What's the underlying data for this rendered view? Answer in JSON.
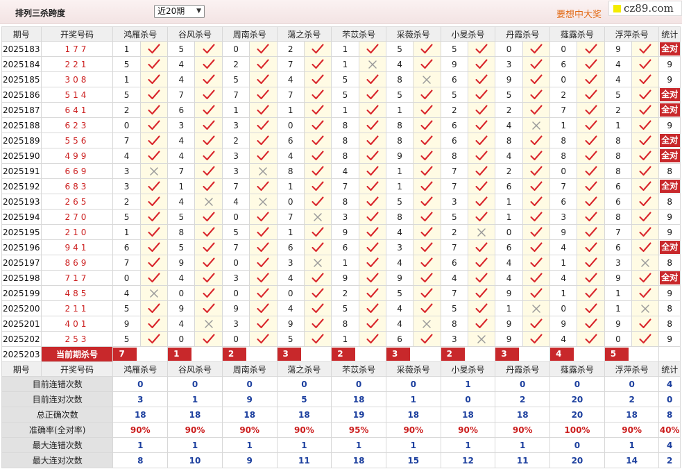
{
  "header": {
    "title": "排列三杀跨度",
    "period_select": "近20期",
    "promo": "要想中大奖",
    "logo_text": "cz89.com"
  },
  "columns": {
    "period": "期号",
    "winning": "开奖号码",
    "experts": [
      "鸿雁杀号",
      "谷风杀号",
      "周南杀号",
      "蕩之杀号",
      "芣苡杀号",
      "采薇杀号",
      "小旻杀号",
      "丹霞杀号",
      "薤露杀号",
      "浮萍杀号"
    ],
    "stat": "统计"
  },
  "icons": {
    "correct": "check-icon",
    "wrong": "cross-icon"
  },
  "colors": {
    "accent_red": "#c8282b",
    "check_red": "#d9262c",
    "cross_gray": "#9a9a9a",
    "stat_blue": "#1c3f9e",
    "marker_bg": "#fffbe4"
  },
  "rows": [
    {
      "period": "2025183",
      "numbers": "177",
      "picks": [
        [
          1,
          1
        ],
        [
          5,
          1
        ],
        [
          0,
          1
        ],
        [
          2,
          1
        ],
        [
          1,
          1
        ],
        [
          5,
          1
        ],
        [
          5,
          1
        ],
        [
          0,
          1
        ],
        [
          0,
          1
        ],
        [
          9,
          1
        ]
      ],
      "stat": "全对",
      "all_correct": true
    },
    {
      "period": "2025184",
      "numbers": "221",
      "picks": [
        [
          5,
          1
        ],
        [
          4,
          1
        ],
        [
          2,
          1
        ],
        [
          7,
          1
        ],
        [
          1,
          0
        ],
        [
          4,
          1
        ],
        [
          9,
          1
        ],
        [
          3,
          1
        ],
        [
          6,
          1
        ],
        [
          4,
          1
        ]
      ],
      "stat": "9",
      "all_correct": false
    },
    {
      "period": "2025185",
      "numbers": "308",
      "picks": [
        [
          1,
          1
        ],
        [
          4,
          1
        ],
        [
          5,
          1
        ],
        [
          4,
          1
        ],
        [
          5,
          1
        ],
        [
          8,
          0
        ],
        [
          6,
          1
        ],
        [
          9,
          1
        ],
        [
          0,
          1
        ],
        [
          4,
          1
        ]
      ],
      "stat": "9",
      "all_correct": false
    },
    {
      "period": "2025186",
      "numbers": "514",
      "picks": [
        [
          5,
          1
        ],
        [
          7,
          1
        ],
        [
          7,
          1
        ],
        [
          7,
          1
        ],
        [
          5,
          1
        ],
        [
          5,
          1
        ],
        [
          5,
          1
        ],
        [
          5,
          1
        ],
        [
          2,
          1
        ],
        [
          5,
          1
        ]
      ],
      "stat": "全对",
      "all_correct": true
    },
    {
      "period": "2025187",
      "numbers": "641",
      "picks": [
        [
          2,
          1
        ],
        [
          6,
          1
        ],
        [
          1,
          1
        ],
        [
          1,
          1
        ],
        [
          1,
          1
        ],
        [
          1,
          1
        ],
        [
          2,
          1
        ],
        [
          2,
          1
        ],
        [
          7,
          1
        ],
        [
          2,
          1
        ]
      ],
      "stat": "全对",
      "all_correct": true
    },
    {
      "period": "2025188",
      "numbers": "623",
      "picks": [
        [
          0,
          1
        ],
        [
          3,
          1
        ],
        [
          3,
          1
        ],
        [
          0,
          1
        ],
        [
          8,
          1
        ],
        [
          8,
          1
        ],
        [
          6,
          1
        ],
        [
          4,
          0
        ],
        [
          1,
          1
        ],
        [
          1,
          1
        ]
      ],
      "stat": "9",
      "all_correct": false
    },
    {
      "period": "2025189",
      "numbers": "556",
      "picks": [
        [
          7,
          1
        ],
        [
          4,
          1
        ],
        [
          2,
          1
        ],
        [
          6,
          1
        ],
        [
          8,
          1
        ],
        [
          8,
          1
        ],
        [
          6,
          1
        ],
        [
          8,
          1
        ],
        [
          8,
          1
        ],
        [
          8,
          1
        ]
      ],
      "stat": "全对",
      "all_correct": true
    },
    {
      "period": "2025190",
      "numbers": "499",
      "picks": [
        [
          4,
          1
        ],
        [
          4,
          1
        ],
        [
          3,
          1
        ],
        [
          4,
          1
        ],
        [
          8,
          1
        ],
        [
          9,
          1
        ],
        [
          8,
          1
        ],
        [
          4,
          1
        ],
        [
          8,
          1
        ],
        [
          8,
          1
        ]
      ],
      "stat": "全对",
      "all_correct": true
    },
    {
      "period": "2025191",
      "numbers": "669",
      "picks": [
        [
          3,
          0
        ],
        [
          7,
          1
        ],
        [
          3,
          0
        ],
        [
          8,
          1
        ],
        [
          4,
          1
        ],
        [
          1,
          1
        ],
        [
          7,
          1
        ],
        [
          2,
          1
        ],
        [
          0,
          1
        ],
        [
          8,
          1
        ]
      ],
      "stat": "8",
      "all_correct": false
    },
    {
      "period": "2025192",
      "numbers": "683",
      "picks": [
        [
          3,
          1
        ],
        [
          1,
          1
        ],
        [
          7,
          1
        ],
        [
          1,
          1
        ],
        [
          7,
          1
        ],
        [
          1,
          1
        ],
        [
          7,
          1
        ],
        [
          6,
          1
        ],
        [
          7,
          1
        ],
        [
          6,
          1
        ]
      ],
      "stat": "全对",
      "all_correct": true
    },
    {
      "period": "2025193",
      "numbers": "265",
      "picks": [
        [
          2,
          1
        ],
        [
          4,
          0
        ],
        [
          4,
          0
        ],
        [
          0,
          1
        ],
        [
          8,
          1
        ],
        [
          5,
          1
        ],
        [
          3,
          1
        ],
        [
          1,
          1
        ],
        [
          6,
          1
        ],
        [
          6,
          1
        ]
      ],
      "stat": "8",
      "all_correct": false
    },
    {
      "period": "2025194",
      "numbers": "270",
      "picks": [
        [
          5,
          1
        ],
        [
          5,
          1
        ],
        [
          0,
          1
        ],
        [
          7,
          0
        ],
        [
          3,
          1
        ],
        [
          8,
          1
        ],
        [
          5,
          1
        ],
        [
          1,
          1
        ],
        [
          3,
          1
        ],
        [
          8,
          1
        ]
      ],
      "stat": "9",
      "all_correct": false
    },
    {
      "period": "2025195",
      "numbers": "210",
      "picks": [
        [
          1,
          1
        ],
        [
          8,
          1
        ],
        [
          5,
          1
        ],
        [
          1,
          1
        ],
        [
          9,
          1
        ],
        [
          4,
          1
        ],
        [
          2,
          0
        ],
        [
          0,
          1
        ],
        [
          9,
          1
        ],
        [
          7,
          1
        ]
      ],
      "stat": "9",
      "all_correct": false
    },
    {
      "period": "2025196",
      "numbers": "941",
      "picks": [
        [
          6,
          1
        ],
        [
          5,
          1
        ],
        [
          7,
          1
        ],
        [
          6,
          1
        ],
        [
          6,
          1
        ],
        [
          3,
          1
        ],
        [
          7,
          1
        ],
        [
          6,
          1
        ],
        [
          4,
          1
        ],
        [
          6,
          1
        ]
      ],
      "stat": "全对",
      "all_correct": true
    },
    {
      "period": "2025197",
      "numbers": "869",
      "picks": [
        [
          7,
          1
        ],
        [
          9,
          1
        ],
        [
          0,
          1
        ],
        [
          3,
          0
        ],
        [
          1,
          1
        ],
        [
          4,
          1
        ],
        [
          6,
          1
        ],
        [
          4,
          1
        ],
        [
          1,
          1
        ],
        [
          3,
          0
        ]
      ],
      "stat": "8",
      "all_correct": false
    },
    {
      "period": "2025198",
      "numbers": "717",
      "picks": [
        [
          0,
          1
        ],
        [
          4,
          1
        ],
        [
          3,
          1
        ],
        [
          4,
          1
        ],
        [
          9,
          1
        ],
        [
          9,
          1
        ],
        [
          4,
          1
        ],
        [
          4,
          1
        ],
        [
          4,
          1
        ],
        [
          9,
          1
        ]
      ],
      "stat": "全对",
      "all_correct": true
    },
    {
      "period": "2025199",
      "numbers": "485",
      "picks": [
        [
          4,
          0
        ],
        [
          0,
          1
        ],
        [
          0,
          1
        ],
        [
          0,
          1
        ],
        [
          2,
          1
        ],
        [
          5,
          1
        ],
        [
          7,
          1
        ],
        [
          9,
          1
        ],
        [
          1,
          1
        ],
        [
          1,
          1
        ]
      ],
      "stat": "9",
      "all_correct": false
    },
    {
      "period": "2025200",
      "numbers": "211",
      "picks": [
        [
          5,
          1
        ],
        [
          9,
          1
        ],
        [
          9,
          1
        ],
        [
          4,
          1
        ],
        [
          5,
          1
        ],
        [
          4,
          1
        ],
        [
          5,
          1
        ],
        [
          1,
          0
        ],
        [
          0,
          1
        ],
        [
          1,
          0
        ]
      ],
      "stat": "8",
      "all_correct": false
    },
    {
      "period": "2025201",
      "numbers": "401",
      "picks": [
        [
          9,
          1
        ],
        [
          4,
          0
        ],
        [
          3,
          1
        ],
        [
          9,
          1
        ],
        [
          8,
          1
        ],
        [
          4,
          0
        ],
        [
          8,
          1
        ],
        [
          9,
          1
        ],
        [
          9,
          1
        ],
        [
          9,
          1
        ]
      ],
      "stat": "8",
      "all_correct": false
    },
    {
      "period": "2025202",
      "numbers": "253",
      "picks": [
        [
          5,
          1
        ],
        [
          0,
          1
        ],
        [
          0,
          1
        ],
        [
          5,
          1
        ],
        [
          1,
          1
        ],
        [
          6,
          1
        ],
        [
          3,
          0
        ],
        [
          9,
          1
        ],
        [
          4,
          1
        ],
        [
          0,
          1
        ]
      ],
      "stat": "9",
      "all_correct": false
    }
  ],
  "current": {
    "period": "2025203",
    "label": "当前期杀号",
    "picks": [
      7,
      1,
      2,
      3,
      2,
      3,
      2,
      3,
      4,
      5
    ],
    "stat": ""
  },
  "summary": [
    {
      "label": "目前连错次数",
      "values": [
        "0",
        "0",
        "0",
        "0",
        "0",
        "0",
        "1",
        "0",
        "0",
        "0"
      ],
      "stat": "4",
      "type": "count"
    },
    {
      "label": "目前连对次数",
      "values": [
        "3",
        "1",
        "9",
        "5",
        "18",
        "1",
        "0",
        "2",
        "20",
        "2"
      ],
      "stat": "0",
      "type": "count"
    },
    {
      "label": "总正确次数",
      "values": [
        "18",
        "18",
        "18",
        "18",
        "19",
        "18",
        "18",
        "18",
        "20",
        "18"
      ],
      "stat": "8",
      "type": "count"
    },
    {
      "label": "准确率(全对率)",
      "values": [
        "90%",
        "90%",
        "90%",
        "90%",
        "95%",
        "90%",
        "90%",
        "90%",
        "100%",
        "90%"
      ],
      "stat": "40%",
      "type": "pct"
    },
    {
      "label": "最大连错次数",
      "values": [
        "1",
        "1",
        "1",
        "1",
        "1",
        "1",
        "1",
        "1",
        "0",
        "1"
      ],
      "stat": "4",
      "type": "count"
    },
    {
      "label": "最大连对次数",
      "values": [
        "8",
        "10",
        "9",
        "11",
        "18",
        "15",
        "12",
        "11",
        "20",
        "14"
      ],
      "stat": "2",
      "type": "count"
    }
  ]
}
